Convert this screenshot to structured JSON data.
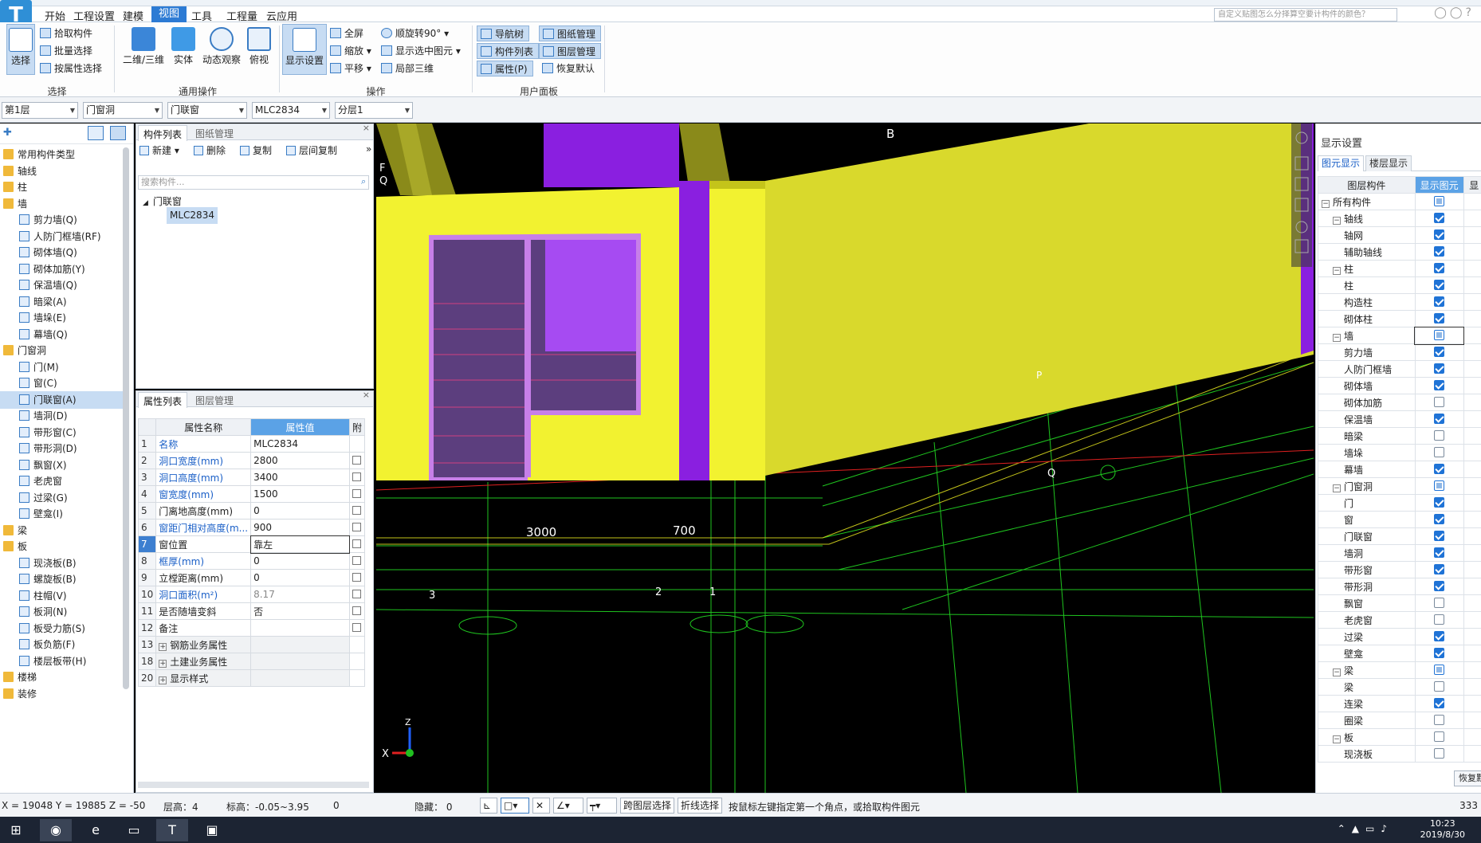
{
  "menu": {
    "items": [
      "开始",
      "工程设置",
      "建模",
      "视图",
      "工具",
      "工程量",
      "云应用"
    ],
    "active": "视图"
  },
  "search": {
    "placeholder": "自定义贴图怎么分择算空要计构件的颜色？"
  },
  "ribbon": {
    "groups": {
      "select": "选择",
      "common": "通用操作",
      "operate": "操作",
      "userpanel": "用户面板"
    },
    "select_big": "选择",
    "pick": "拾取构件",
    "batch": "批量选择",
    "byprop": "按属性选择",
    "view2d3d": "二维/三维",
    "solid": "实体",
    "orbit": "动态观察",
    "topview": "俯视",
    "display_settings": "显示设置",
    "fullscreen": "全屏",
    "rotate90": "顺旋转90°",
    "zoom": "缩放",
    "show_selected": "显示选中图元",
    "pan": "平移",
    "local3d": "局部三维",
    "navtree": "导航树",
    "drawing_mgmt": "图纸管理",
    "comp_list": "构件列表",
    "layer_mgmt": "图层管理",
    "props": "属性(P)",
    "restore_default": "恢复默认"
  },
  "selectors": [
    "第1层",
    "门窗洞",
    "门联窗",
    "MLC2834",
    "分层1"
  ],
  "leftnav": {
    "items": [
      {
        "label": "常用构件类型",
        "type": "folder"
      },
      {
        "label": "轴线",
        "type": "folder"
      },
      {
        "label": "柱",
        "type": "folder"
      },
      {
        "label": "墙",
        "type": "folder"
      },
      {
        "label": "剪力墙(Q)",
        "type": "item"
      },
      {
        "label": "人防门框墙(RF)",
        "type": "item"
      },
      {
        "label": "砌体墙(Q)",
        "type": "item"
      },
      {
        "label": "砌体加筋(Y)",
        "type": "item"
      },
      {
        "label": "保温墙(Q)",
        "type": "item"
      },
      {
        "label": "暗梁(A)",
        "type": "item"
      },
      {
        "label": "墙垛(E)",
        "type": "item"
      },
      {
        "label": "幕墙(Q)",
        "type": "item"
      },
      {
        "label": "门窗洞",
        "type": "folder"
      },
      {
        "label": "门(M)",
        "type": "item"
      },
      {
        "label": "窗(C)",
        "type": "item"
      },
      {
        "label": "门联窗(A)",
        "type": "item",
        "selected": true
      },
      {
        "label": "墙洞(D)",
        "type": "item"
      },
      {
        "label": "带形窗(C)",
        "type": "item"
      },
      {
        "label": "带形洞(D)",
        "type": "item"
      },
      {
        "label": "飘窗(X)",
        "type": "item"
      },
      {
        "label": "老虎窗",
        "type": "item"
      },
      {
        "label": "过梁(G)",
        "type": "item"
      },
      {
        "label": "壁龛(I)",
        "type": "item"
      },
      {
        "label": "梁",
        "type": "folder"
      },
      {
        "label": "板",
        "type": "folder"
      },
      {
        "label": "现浇板(B)",
        "type": "item"
      },
      {
        "label": "螺旋板(B)",
        "type": "item"
      },
      {
        "label": "柱帽(V)",
        "type": "item"
      },
      {
        "label": "板洞(N)",
        "type": "item"
      },
      {
        "label": "板受力筋(S)",
        "type": "item"
      },
      {
        "label": "板负筋(F)",
        "type": "item"
      },
      {
        "label": "楼层板带(H)",
        "type": "item"
      },
      {
        "label": "楼梯",
        "type": "folder"
      },
      {
        "label": "装修",
        "type": "folder"
      }
    ]
  },
  "complist": {
    "tabs": [
      "构件列表",
      "图纸管理"
    ],
    "toolbar": {
      "new": "新建",
      "delete": "删除",
      "copy": "复制",
      "floor_copy": "层间复制"
    },
    "search_placeholder": "搜索构件...",
    "tree_root": "门联窗",
    "tree_child": "MLC2834"
  },
  "proplist": {
    "tabs": [
      "属性列表",
      "图层管理"
    ],
    "col_name": "属性名称",
    "col_value": "属性值",
    "col_extra": "附",
    "rows": [
      {
        "n": "1",
        "name": "名称",
        "value": "MLC2834",
        "style": "blue",
        "chk": false
      },
      {
        "n": "2",
        "name": "洞口宽度(mm)",
        "value": "2800",
        "style": "blue",
        "chk": true
      },
      {
        "n": "3",
        "name": "洞口高度(mm)",
        "value": "3400",
        "style": "blue",
        "chk": true
      },
      {
        "n": "4",
        "name": "窗宽度(mm)",
        "value": "1500",
        "style": "blue",
        "chk": true
      },
      {
        "n": "5",
        "name": "门离地高度(mm)",
        "value": "0",
        "style": "",
        "chk": true
      },
      {
        "n": "6",
        "name": "窗距门相对高度(m...",
        "value": "900",
        "style": "blue",
        "chk": true
      },
      {
        "n": "7",
        "name": "窗位置",
        "value": "靠左",
        "style": "",
        "chk": true,
        "active": true
      },
      {
        "n": "8",
        "name": "框厚(mm)",
        "value": "0",
        "style": "blue",
        "chk": true
      },
      {
        "n": "9",
        "name": "立樘距离(mm)",
        "value": "0",
        "style": "",
        "chk": true
      },
      {
        "n": "10",
        "name": "洞口面积(m²)",
        "value": "8.17",
        "style": "blue",
        "chk": true,
        "valgray": true
      },
      {
        "n": "11",
        "name": "是否随墙变斜",
        "value": "否",
        "style": "",
        "chk": true
      },
      {
        "n": "12",
        "name": "备注",
        "value": "",
        "style": "",
        "chk": true
      },
      {
        "n": "13",
        "name": "钢筋业务属性",
        "value": "",
        "style": "grp",
        "chk": false
      },
      {
        "n": "18",
        "name": "土建业务属性",
        "value": "",
        "style": "grp",
        "chk": false
      },
      {
        "n": "20",
        "name": "显示样式",
        "value": "",
        "style": "grp",
        "chk": false
      }
    ]
  },
  "viewport": {
    "dim_labels": [
      "3000",
      "700"
    ],
    "axis_labels": [
      "B",
      "F",
      "Q",
      "P",
      "Q",
      "3",
      "2",
      "1"
    ],
    "axis_x": "X",
    "axis_z": "Z"
  },
  "display": {
    "title": "显示设置",
    "tabs": [
      "图元显示",
      "楼层显示"
    ],
    "col_layer": "图层构件",
    "col_show": "显示图元",
    "col_extra": "显",
    "rows": [
      {
        "label": "所有构件",
        "level": 0,
        "exp": "-",
        "state": "part"
      },
      {
        "label": "轴线",
        "level": 1,
        "exp": "-",
        "state": "on"
      },
      {
        "label": "轴网",
        "level": 2,
        "state": "on"
      },
      {
        "label": "辅助轴线",
        "level": 2,
        "state": "on"
      },
      {
        "label": "柱",
        "level": 1,
        "exp": "-",
        "state": "on"
      },
      {
        "label": "柱",
        "level": 2,
        "state": "on"
      },
      {
        "label": "构造柱",
        "level": 2,
        "state": "on"
      },
      {
        "label": "砌体柱",
        "level": 2,
        "state": "on"
      },
      {
        "label": "墙",
        "level": 1,
        "exp": "-",
        "state": "part",
        "boxed": true
      },
      {
        "label": "剪力墙",
        "level": 2,
        "state": "on"
      },
      {
        "label": "人防门框墙",
        "level": 2,
        "state": "on"
      },
      {
        "label": "砌体墙",
        "level": 2,
        "state": "on"
      },
      {
        "label": "砌体加筋",
        "level": 2,
        "state": "off"
      },
      {
        "label": "保温墙",
        "level": 2,
        "state": "on"
      },
      {
        "label": "暗梁",
        "level": 2,
        "state": "off"
      },
      {
        "label": "墙垛",
        "level": 2,
        "state": "off"
      },
      {
        "label": "幕墙",
        "level": 2,
        "state": "on"
      },
      {
        "label": "门窗洞",
        "level": 1,
        "exp": "-",
        "state": "part"
      },
      {
        "label": "门",
        "level": 2,
        "state": "on"
      },
      {
        "label": "窗",
        "level": 2,
        "state": "on"
      },
      {
        "label": "门联窗",
        "level": 2,
        "state": "on"
      },
      {
        "label": "墙洞",
        "level": 2,
        "state": "on"
      },
      {
        "label": "带形窗",
        "level": 2,
        "state": "on"
      },
      {
        "label": "带形洞",
        "level": 2,
        "state": "on"
      },
      {
        "label": "飘窗",
        "level": 2,
        "state": "off"
      },
      {
        "label": "老虎窗",
        "level": 2,
        "state": "off"
      },
      {
        "label": "过梁",
        "level": 2,
        "state": "on"
      },
      {
        "label": "壁龛",
        "level": 2,
        "state": "on"
      },
      {
        "label": "梁",
        "level": 1,
        "exp": "-",
        "state": "part"
      },
      {
        "label": "梁",
        "level": 2,
        "state": "off"
      },
      {
        "label": "连梁",
        "level": 2,
        "state": "on"
      },
      {
        "label": "圈梁",
        "level": 2,
        "state": "off"
      },
      {
        "label": "板",
        "level": 1,
        "exp": "-",
        "state": "off"
      },
      {
        "label": "现浇板",
        "level": 2,
        "state": "off"
      }
    ],
    "restore": "恢复默"
  },
  "status": {
    "coords": "X = 19048 Y = 19885 Z = -50",
    "floor_height": "层高：4",
    "elevation": "标高：-0.05~3.95",
    "count": "0",
    "hidden": "隐藏： 0",
    "cross_layer": "跨图层选择",
    "polyline": "折线选择",
    "hint": "按鼠标左键指定第一个角点，或拾取构件图元",
    "right_num": "333"
  },
  "taskbar": {
    "time": "10:23",
    "date": "2019/8/30"
  },
  "colors": {
    "accent": "#2d7bd4",
    "wall_yellow": "#e6e629",
    "purple": "#8a1fe0",
    "window": "#5a3a78"
  }
}
